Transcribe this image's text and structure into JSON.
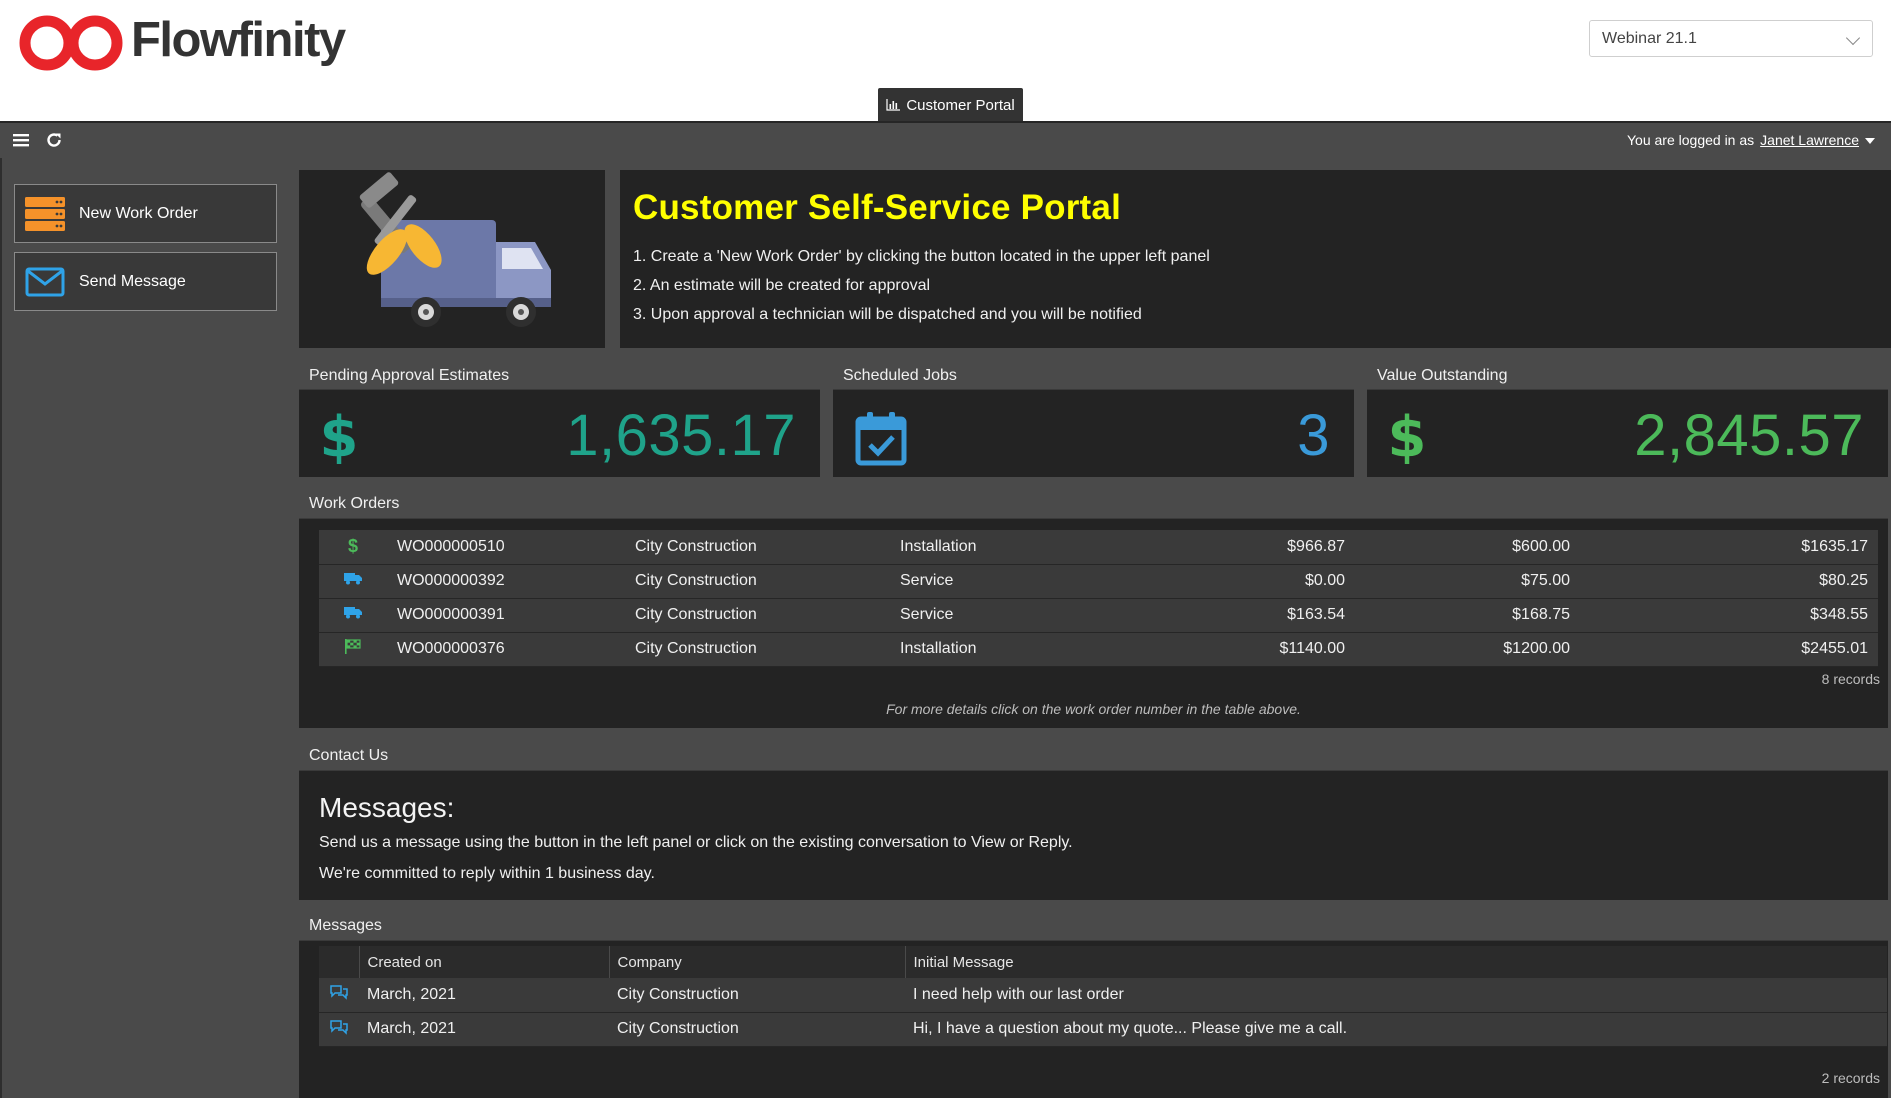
{
  "header": {
    "brand": "Flowfinity",
    "workspace_selected": "Webinar 21.1",
    "active_tab": "Customer Portal"
  },
  "toolbar": {
    "logged_in_prefix": "You are logged in as",
    "user_name": "Janet Lawrence"
  },
  "left_panel": {
    "buttons": [
      {
        "label": "New Work Order",
        "icon": "server-stack-icon",
        "color": "#f5922a"
      },
      {
        "label": "Send Message",
        "icon": "envelope-icon",
        "color": "#2fa3e8"
      }
    ]
  },
  "hero": {
    "title": "Customer Self-Service Portal",
    "steps": [
      "1. Create a 'New Work Order' by clicking the button located in the upper left panel",
      "2. An estimate will be created for approval",
      "3. Upon approval a technician will be dispatched and you will be notified"
    ],
    "image_icon": "truck-with-tools-icon"
  },
  "kpis": [
    {
      "title": "Pending Approval Estimates",
      "value": "1,635.17",
      "icon": "dollar-icon",
      "color": "#1fa38a"
    },
    {
      "title": "Scheduled Jobs",
      "value": "3",
      "icon": "calendar-check-icon",
      "color": "#3a9ad9"
    },
    {
      "title": "Value Outstanding",
      "value": "2,845.57",
      "icon": "dollar-icon",
      "color": "#4cba5a"
    }
  ],
  "work_orders": {
    "title": "Work Orders",
    "rows": [
      {
        "status_icon": "dollar-icon",
        "id": "WO000000510",
        "company": "City Construction",
        "type": "Installation",
        "a": "$966.87",
        "b": "$600.00",
        "c": "$1635.17"
      },
      {
        "status_icon": "truck-icon",
        "id": "WO000000392",
        "company": "City Construction",
        "type": "Service",
        "a": "$0.00",
        "b": "$75.00",
        "c": "$80.25"
      },
      {
        "status_icon": "truck-icon",
        "id": "WO000000391",
        "company": "City Construction",
        "type": "Service",
        "a": "$163.54",
        "b": "$168.75",
        "c": "$348.55"
      },
      {
        "status_icon": "checkered-flag-icon",
        "id": "WO000000376",
        "company": "City Construction",
        "type": "Installation",
        "a": "$1140.00",
        "b": "$1200.00",
        "c": "$2455.01"
      }
    ],
    "records": "8 records",
    "hint": "For more details click on the work order number in the table above."
  },
  "contact": {
    "title": "Contact Us",
    "heading": "Messages:",
    "line1": "Send us a message using the button in the left panel or click on the existing conversation to View or Reply.",
    "line2": "We're committed to reply within 1 business day."
  },
  "messages": {
    "title": "Messages",
    "columns": [
      "Created on",
      "Company",
      "Initial Message"
    ],
    "rows": [
      {
        "created": "March, 2021",
        "company": "City Construction",
        "message": "I need help with our last order"
      },
      {
        "created": "March, 2021",
        "company": "City Construction",
        "message": "Hi, I have a question about my quote... Please give me a call."
      }
    ],
    "records": "2 records"
  }
}
